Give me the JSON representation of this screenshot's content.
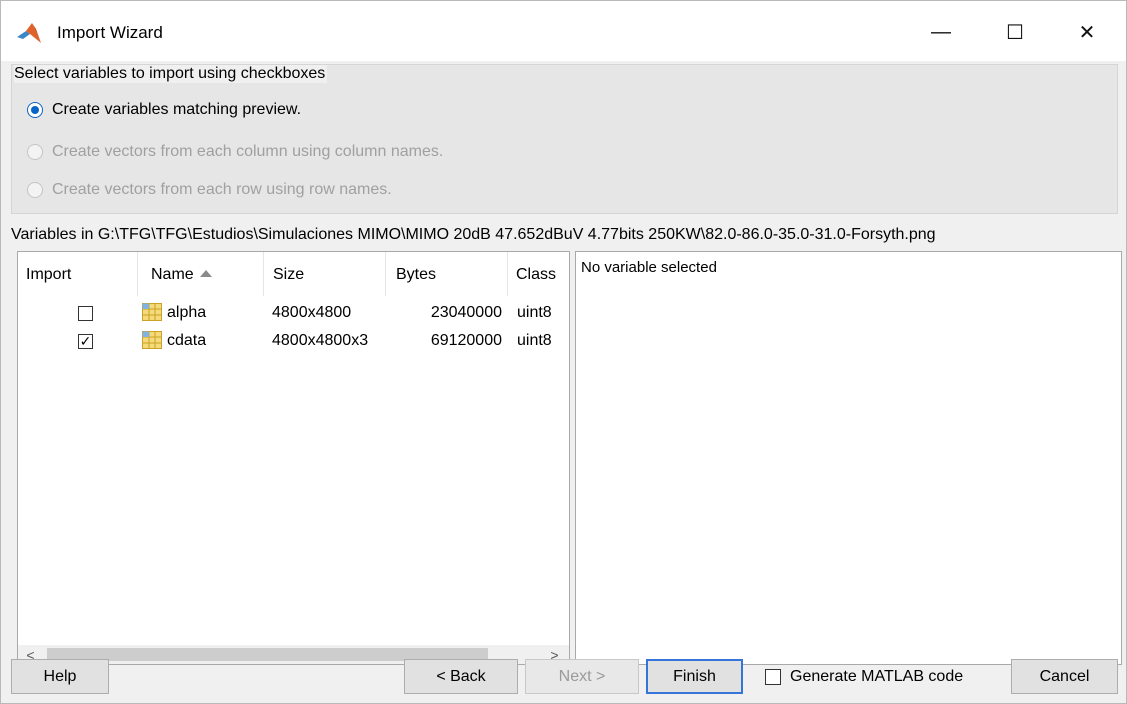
{
  "window": {
    "title": "Import Wizard",
    "controls": {
      "minimize": "—",
      "maximize": "☐",
      "close": "✕"
    }
  },
  "options": {
    "legend": "Select variables to import using checkboxes",
    "radios": [
      {
        "label": "Create variables matching preview.",
        "checked": true,
        "enabled": true
      },
      {
        "label": "Create vectors from each column using column names.",
        "checked": false,
        "enabled": false
      },
      {
        "label": "Create vectors from each row using row names.",
        "checked": false,
        "enabled": false
      }
    ]
  },
  "variables_path": "Variables in G:\\TFG\\TFG\\Estudios\\Simulaciones MIMO\\MIMO 20dB 47.652dBuV 4.77bits 250KW\\82.0-86.0-35.0-31.0-Forsyth.png",
  "table": {
    "columns": [
      "Import",
      "Name",
      "Size",
      "Bytes",
      "Class"
    ],
    "sort_column": "Name",
    "rows": [
      {
        "import": false,
        "name": "alpha",
        "size": "4800x4800",
        "bytes": "23040000",
        "class": "uint8"
      },
      {
        "import": true,
        "name": "cdata",
        "size": "4800x4800x3",
        "bytes": "69120000",
        "class": "uint8"
      }
    ],
    "scroll_left": "<",
    "scroll_right": ">"
  },
  "preview": {
    "text": "No variable selected"
  },
  "buttons": {
    "help": "Help",
    "back": "< Back",
    "next": "Next >",
    "finish": "Finish",
    "generate_code": "Generate MATLAB code",
    "cancel": "Cancel"
  },
  "icons": {
    "app": "matlab-logo-icon",
    "variable": "matrix-variable-icon"
  },
  "colors": {
    "accent": "#0a64c8",
    "finish_border": "#3574d8",
    "disabled_text": "#a0a0a0"
  }
}
